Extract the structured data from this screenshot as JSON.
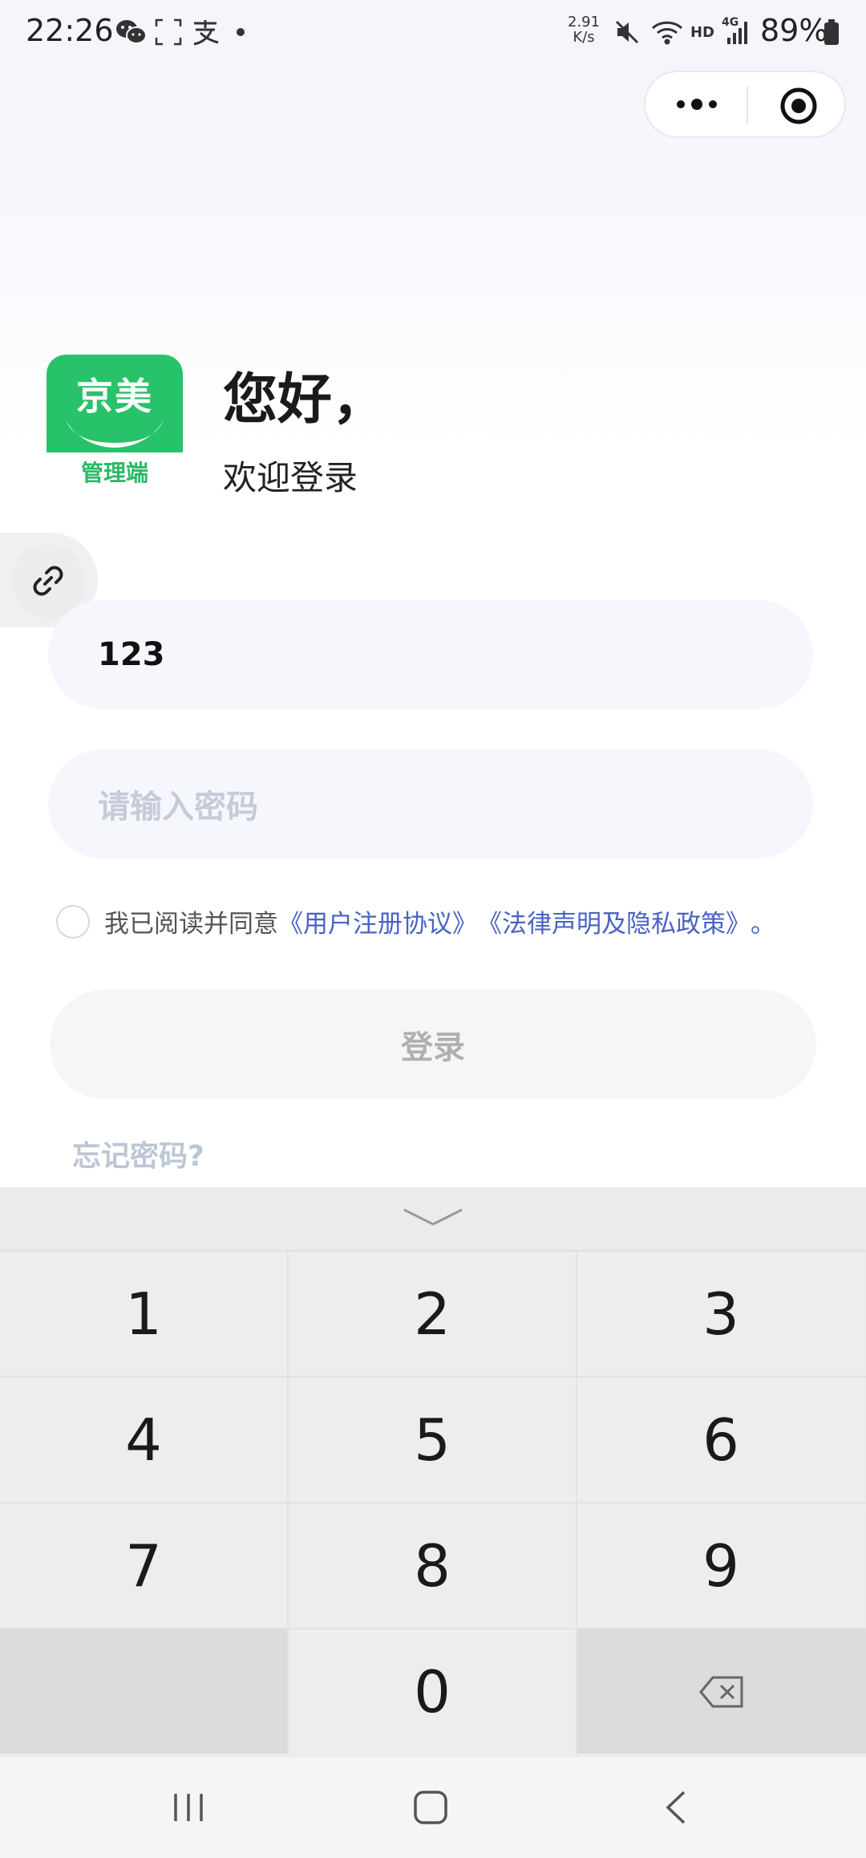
{
  "status_bar": {
    "time": "22:26",
    "net_speed_value": "2.91",
    "net_speed_unit": "K/s",
    "hd_label": "HD",
    "network_label": "4G",
    "battery": "89%"
  },
  "header": {
    "logo_text": "京美",
    "logo_subtext": "管理端",
    "greeting": "您好，",
    "welcome": "欢迎登录"
  },
  "form": {
    "account_value": "123",
    "password_placeholder": "请输入密码",
    "agree_prefix": "我已阅读并同意",
    "user_agreement": "《用户注册协议》",
    "privacy_policy": "《法律声明及隐私政策》",
    "agree_suffix": "。",
    "login_label": "登录",
    "forgot_label": "忘记密码?"
  },
  "keyboard": {
    "keys": [
      "1",
      "2",
      "3",
      "4",
      "5",
      "6",
      "7",
      "8",
      "9",
      "0"
    ]
  },
  "colors": {
    "brand_green": "#28c26a",
    "link_blue": "#4a62c4"
  }
}
